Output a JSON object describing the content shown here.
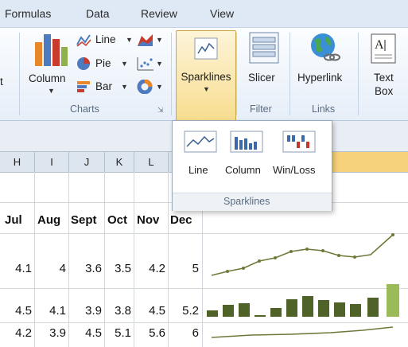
{
  "menubar": {
    "items": [
      "Formulas",
      "Data",
      "Review",
      "View"
    ]
  },
  "ribbon": {
    "partial_left_label": "t",
    "charts": {
      "column_label": "Column",
      "line_label": "Line",
      "pie_label": "Pie",
      "bar_label": "Bar",
      "group_label": "Charts"
    },
    "sparklines_button_label": "Sparklines",
    "filter": {
      "slicer_label": "Slicer",
      "group_label": "Filter"
    },
    "links": {
      "hyperlink_label": "Hyperlink",
      "group_label": "Links"
    },
    "text": {
      "textbox_label_line1": "Text",
      "textbox_label_line2": "Box"
    }
  },
  "sparklines_menu": {
    "items": [
      "Line",
      "Column",
      "Win/Loss"
    ],
    "footer_label": "Sparklines"
  },
  "sheet": {
    "columns": [
      "H",
      "I",
      "J",
      "K",
      "L"
    ],
    "month_headers": [
      "Jul",
      "Aug",
      "Sept",
      "Oct",
      "Nov",
      "Dec"
    ],
    "rows": [
      [
        "4.1",
        "4",
        "3.6",
        "3.5",
        "4.2",
        "5"
      ],
      [
        "4.5",
        "4.1",
        "3.9",
        "3.8",
        "4.5",
        "5.2"
      ],
      [
        "4.2",
        "3.9",
        "4.5",
        "5.1",
        "5.6",
        "6"
      ]
    ]
  },
  "colors": {
    "sparkline_line": "#6b7a3a",
    "sparkline_bar": "#4f6228",
    "sparkline_bar_highlight": "#9bbb59",
    "selected_header": "#f6d37a"
  }
}
